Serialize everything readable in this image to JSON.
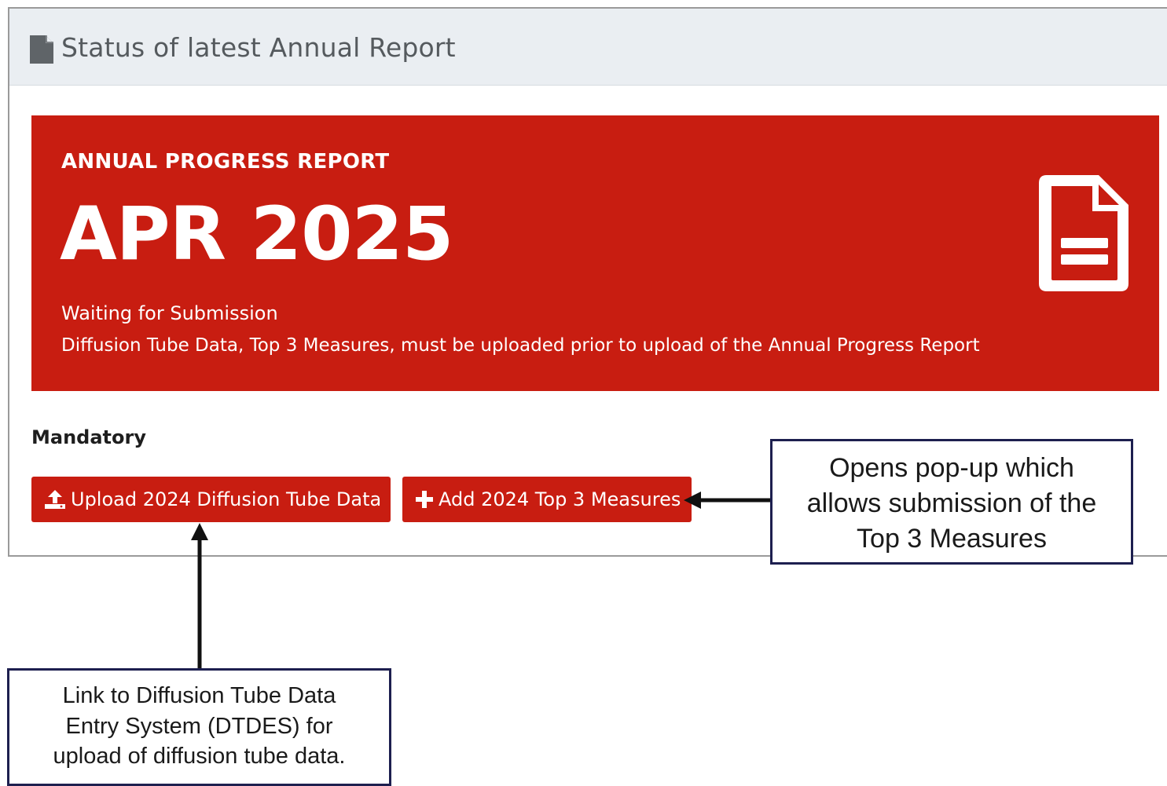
{
  "panel": {
    "header_icon": "file-icon",
    "title": "Status of latest Annual Report"
  },
  "banner": {
    "kicker": "ANNUAL PROGRESS REPORT",
    "headline": "APR 2025",
    "status": "Waiting for Submission",
    "note": "Diffusion Tube Data, Top 3 Measures, must be uploaded prior to upload of the Annual Progress Report",
    "icon": "file-text-icon",
    "color": "#c81d11"
  },
  "mandatory": {
    "label": "Mandatory",
    "buttons": [
      {
        "label": "Upload 2024 Diffusion Tube Data",
        "icon": "upload-icon"
      },
      {
        "label": "Add 2024 Top 3 Measures",
        "icon": "plus-icon"
      }
    ]
  },
  "annotations": {
    "right_lines": [
      "Opens pop-up which",
      "allows submission of the",
      "Top 3 Measures"
    ],
    "left_lines": [
      "Link to Diffusion Tube Data",
      "Entry System (DTDES) for",
      "upload of diffusion tube data."
    ]
  }
}
